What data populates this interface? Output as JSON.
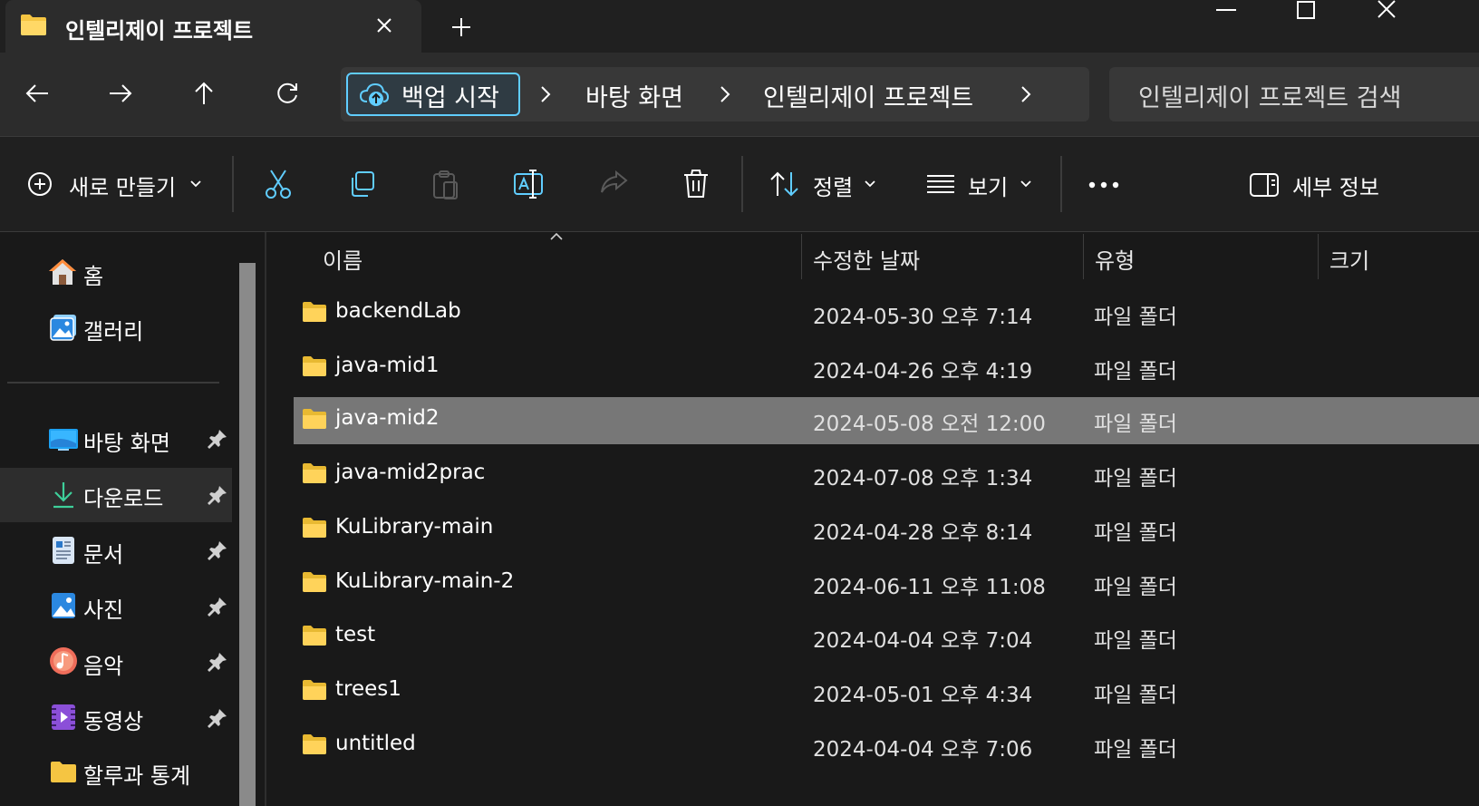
{
  "window": {
    "tab_title": "인텔리제이 프로젝트",
    "controls": [
      "minimize",
      "maximize",
      "close"
    ]
  },
  "nav": {
    "backup_label": "백업 시작",
    "breadcrumbs": [
      "바탕 화면",
      "인텔리제이 프로젝트"
    ],
    "search_placeholder": "인텔리제이 프로젝트 검색"
  },
  "toolbar": {
    "new_label": "새로 만들기",
    "sort_label": "정렬",
    "view_label": "보기",
    "details_label": "세부 정보"
  },
  "sidebar": {
    "top_items": [
      {
        "label": "홈",
        "icon": "home-icon"
      },
      {
        "label": "갤러리",
        "icon": "gallery-icon"
      }
    ],
    "pinned_items": [
      {
        "label": "바탕 화면",
        "icon": "desktop-icon"
      },
      {
        "label": "다운로드",
        "icon": "download-icon"
      },
      {
        "label": "문서",
        "icon": "document-icon"
      },
      {
        "label": "사진",
        "icon": "pictures-icon"
      },
      {
        "label": "음악",
        "icon": "music-icon"
      },
      {
        "label": "동영상",
        "icon": "video-icon"
      },
      {
        "label": "할루과 통계",
        "icon": "folder-icon"
      }
    ]
  },
  "list": {
    "columns": [
      "이름",
      "수정한 날짜",
      "유형",
      "크기"
    ],
    "rows": [
      {
        "name": "backendLab",
        "date": "2024-05-30 오후 7:14",
        "type": "파일 폴더"
      },
      {
        "name": "java-mid1",
        "date": "2024-04-26 오후 4:19",
        "type": "파일 폴더"
      },
      {
        "name": "java-mid2",
        "date": "2024-05-08 오전 12:00",
        "type": "파일 폴더"
      },
      {
        "name": "java-mid2prac",
        "date": "2024-07-08 오후 1:34",
        "type": "파일 폴더"
      },
      {
        "name": "KuLibrary-main",
        "date": "2024-04-28 오후 8:14",
        "type": "파일 폴더"
      },
      {
        "name": "KuLibrary-main-2",
        "date": "2024-06-11 오후 11:08",
        "type": "파일 폴더"
      },
      {
        "name": "test",
        "date": "2024-04-04 오후 7:04",
        "type": "파일 폴더"
      },
      {
        "name": "trees1",
        "date": "2024-05-01 오후 4:34",
        "type": "파일 폴더"
      },
      {
        "name": "untitled",
        "date": "2024-04-04 오후 7:06",
        "type": "파일 폴더"
      }
    ],
    "selected_row": "java-mid2"
  },
  "colors": {
    "accent": "#60cdff",
    "folder": "#f5c542",
    "selection": "#777777"
  }
}
